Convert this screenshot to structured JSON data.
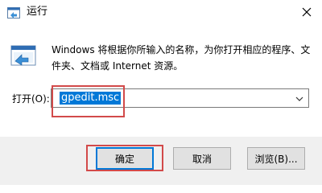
{
  "window": {
    "title": "运行",
    "close_icon": "close-icon",
    "app_icon": "run-app-icon"
  },
  "content": {
    "description": "Windows 将根据你所输入的名称，为你打开相应的程序、文件夹、文档或 Internet 资源。",
    "open_label": "打开(O):",
    "open_value": "gpedit.msc"
  },
  "buttons": {
    "ok": "确定",
    "cancel": "取消",
    "browse": "浏览(B)..."
  },
  "colors": {
    "highlight": "#d24a4a",
    "selection": "#0078d7",
    "footer_bg": "#f0f0f0"
  }
}
